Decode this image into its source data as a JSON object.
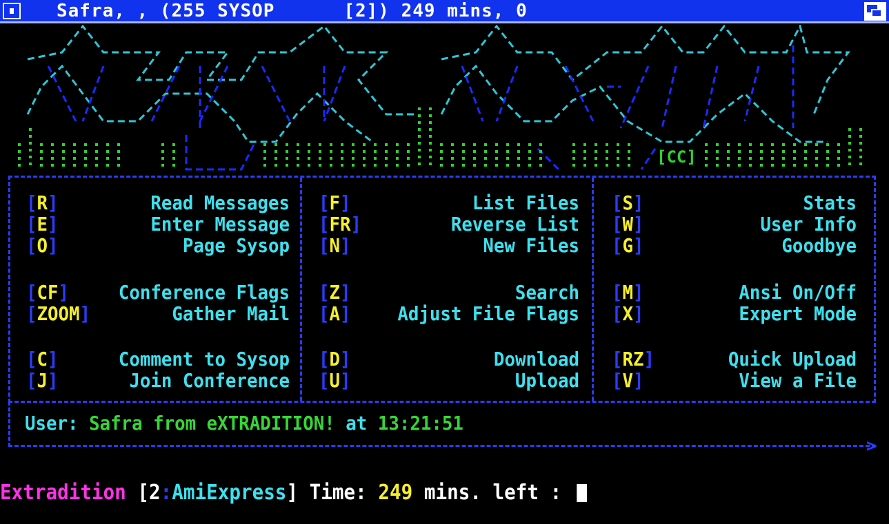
{
  "titlebar": {
    "title": "Safra, , (255 SYSOP      [2]) 249 mins, 0"
  },
  "logo": {
    "tag": "[CC]"
  },
  "menu": {
    "columns": [
      {
        "items": [
          {
            "key": "R",
            "label": "Read Messages"
          },
          {
            "key": "E",
            "label": "Enter Message"
          },
          {
            "key": "O",
            "label": "Page Sysop"
          },
          {
            "key": "CF",
            "label": "Conference Flags"
          },
          {
            "key": "ZOOM",
            "label": "Gather Mail"
          },
          {
            "key": "C",
            "label": "Comment to Sysop"
          },
          {
            "key": "J",
            "label": "Join Conference"
          }
        ]
      },
      {
        "items": [
          {
            "key": "F",
            "label": "List Files"
          },
          {
            "key": "FR",
            "label": "Reverse List"
          },
          {
            "key": "N",
            "label": "New Files"
          },
          {
            "key": "Z",
            "label": "Search"
          },
          {
            "key": "A",
            "label": "Adjust File Flags"
          },
          {
            "key": "D",
            "label": "Download"
          },
          {
            "key": "U",
            "label": "Upload"
          }
        ]
      },
      {
        "items": [
          {
            "key": "S",
            "label": "Stats"
          },
          {
            "key": "W",
            "label": "User Info"
          },
          {
            "key": "G",
            "label": "Goodbye"
          },
          {
            "key": "M",
            "label": "Ansi On/Off"
          },
          {
            "key": "X",
            "label": "Expert Mode"
          },
          {
            "key": "RZ",
            "label": "Quick Upload"
          },
          {
            "key": "V",
            "label": "View a File"
          }
        ]
      }
    ]
  },
  "user_info": {
    "label": "User: ",
    "name": "Safra from eXTRADITION!",
    "at": " at ",
    "time": "13:21:51"
  },
  "prompt": {
    "bbs": "Extradition",
    "open": " [",
    "node": "2",
    "colon": ":",
    "software": "AmiExpress",
    "close": "] ",
    "time_label": "Time: ",
    "mins": "249",
    "rest": " mins. left : "
  },
  "colors": {
    "background": "#000000",
    "titlebar": "#1133ee",
    "key": "#f5ef2c",
    "label": "#3ee0ee",
    "border": "#2a3cff",
    "user": "#36d637",
    "bbs_name": "#ff33e6",
    "logo_cyan": "#2ec7d6",
    "logo_blue": "#1a2bff",
    "logo_green": "#2fd12f"
  }
}
